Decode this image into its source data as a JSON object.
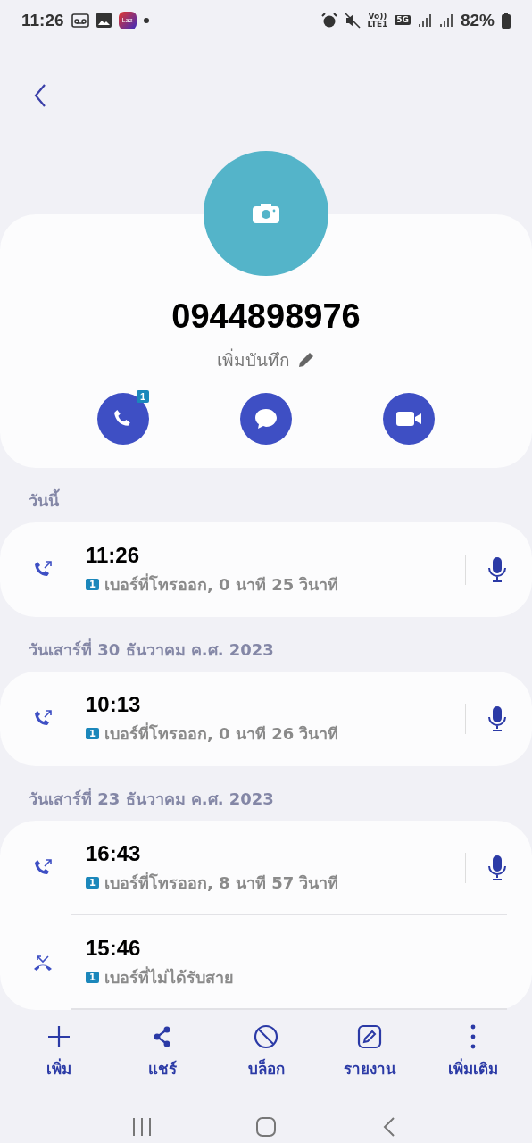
{
  "status_bar": {
    "time": "11:26",
    "volte": "Vo))",
    "lte": "LTE1",
    "network": "5G",
    "battery": "82%",
    "app_badge": "Laz"
  },
  "contact": {
    "number": "0944898976",
    "note": "เพิ่มบันทึก",
    "call_badge": "1"
  },
  "sections": [
    {
      "date": "วันนี้",
      "calls": [
        {
          "kind": "outgoing",
          "time": "11:26",
          "sim": "1",
          "detail": "เบอร์ที่โทรออก, 0 นาที 25 วินาที",
          "recording": true
        }
      ]
    },
    {
      "date": "วันเสาร์ที่ 30 ธันวาคม ค.ศ. 2023",
      "calls": [
        {
          "kind": "outgoing",
          "time": "10:13",
          "sim": "1",
          "detail": "เบอร์ที่โทรออก, 0 นาที 26 วินาที",
          "recording": true
        }
      ]
    },
    {
      "date": "วันเสาร์ที่ 23 ธันวาคม ค.ศ. 2023",
      "calls": [
        {
          "kind": "outgoing",
          "time": "16:43",
          "sim": "1",
          "detail": "เบอร์ที่โทรออก, 8 นาที 57 วินาที",
          "recording": true
        },
        {
          "kind": "missed",
          "time": "15:46",
          "sim": "1",
          "detail": "เบอร์ที่ไม่ได้รับสาย",
          "recording": false
        }
      ]
    }
  ],
  "toolbar": [
    {
      "kind": "add",
      "label": "เพิ่ม"
    },
    {
      "kind": "share",
      "label": "แชร์"
    },
    {
      "kind": "block",
      "label": "บล็อก"
    },
    {
      "kind": "report",
      "label": "รายงาน"
    },
    {
      "kind": "more",
      "label": "เพิ่มเติม"
    }
  ]
}
